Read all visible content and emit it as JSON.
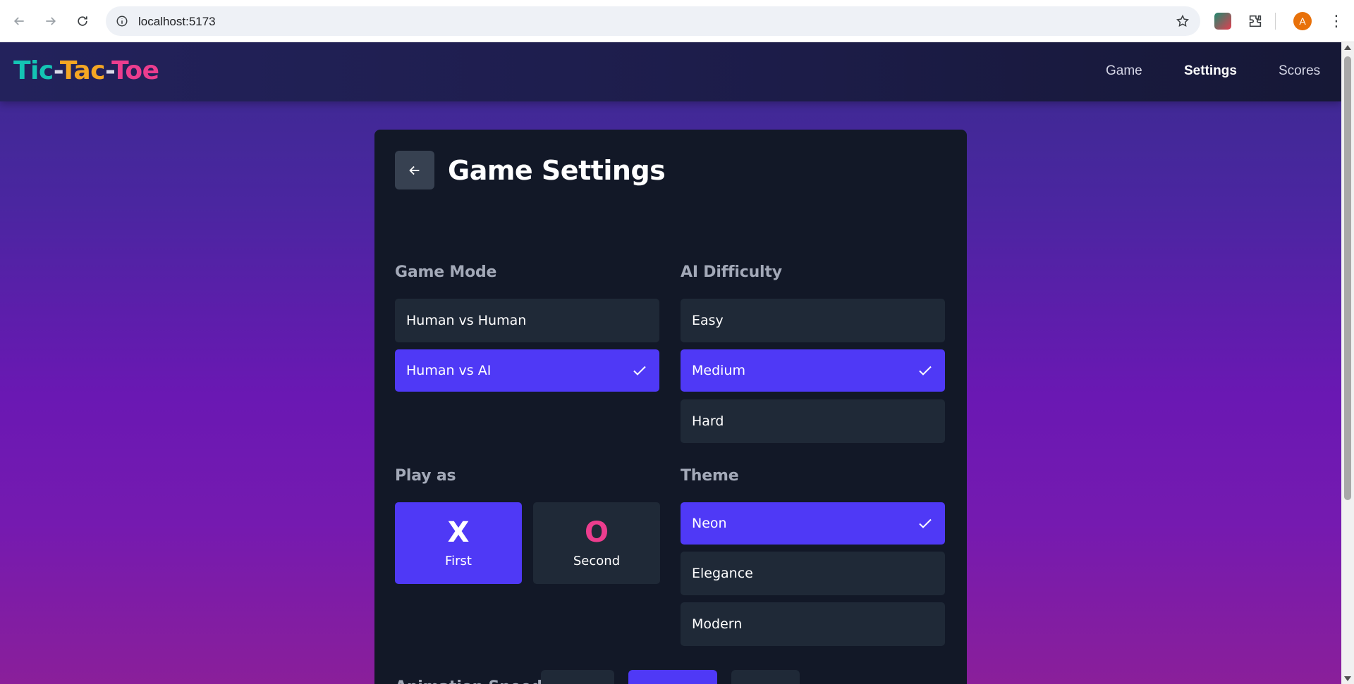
{
  "browser": {
    "url": "localhost:5173",
    "avatar_letter": "A",
    "icons": [
      "back-arrow-icon",
      "forward-arrow-icon",
      "reload-icon",
      "info-icon",
      "star-icon",
      "extension-icon",
      "puzzle-icon",
      "menu-dots-icon"
    ]
  },
  "app": {
    "logo": {
      "part1": "Tic",
      "part2": "Tac",
      "part3": "Toe",
      "dash": "-"
    },
    "logo_colors": {
      "tic": "#14c4b4",
      "tac": "#f5a623",
      "toe": "#ec3d8e"
    },
    "nav": [
      {
        "label": "Game",
        "active": false
      },
      {
        "label": "Settings",
        "active": true
      },
      {
        "label": "Scores",
        "active": false
      }
    ]
  },
  "settings": {
    "title": "Game Settings",
    "game_mode": {
      "label": "Game Mode",
      "options": [
        {
          "label": "Human vs Human",
          "selected": false
        },
        {
          "label": "Human vs AI",
          "selected": true
        }
      ]
    },
    "ai_difficulty": {
      "label": "AI Difficulty",
      "options": [
        {
          "label": "Easy",
          "selected": false
        },
        {
          "label": "Medium",
          "selected": true
        },
        {
          "label": "Hard",
          "selected": false
        }
      ]
    },
    "play_as": {
      "label": "Play as",
      "options": [
        {
          "symbol": "X",
          "caption": "First",
          "selected": true,
          "color": "#ffffff"
        },
        {
          "symbol": "O",
          "caption": "Second",
          "selected": false,
          "color": "#ec3d8e"
        }
      ]
    },
    "theme": {
      "label": "Theme",
      "options": [
        {
          "label": "Neon",
          "selected": true
        },
        {
          "label": "Elegance",
          "selected": false
        },
        {
          "label": "Modern",
          "selected": false
        }
      ]
    },
    "animation_speed": {
      "label": "Animation Speed"
    }
  },
  "colors": {
    "accent": "#4f39f6",
    "card_bg": "#121827",
    "option_bg": "#1f2937"
  }
}
